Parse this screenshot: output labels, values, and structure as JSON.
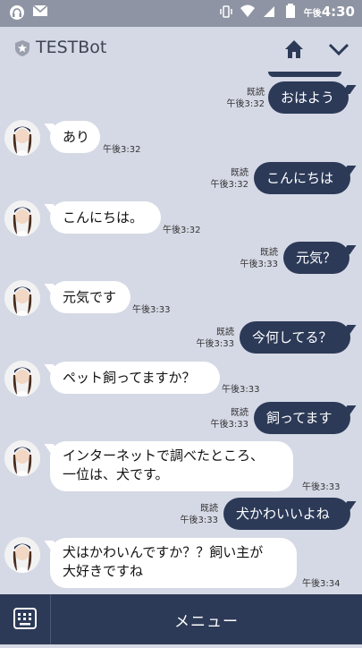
{
  "status_bar": {
    "time_prefix": "午後",
    "time": "4:30"
  },
  "header": {
    "title": "TESTBot",
    "icons": [
      "star-badge-icon",
      "home-icon",
      "chevron-down-icon"
    ]
  },
  "messages": [
    {
      "from": "me",
      "text": "おはよう",
      "read": "既読",
      "time": "午後3:32"
    },
    {
      "from": "bot",
      "text": "あり",
      "time": "午後3:32"
    },
    {
      "from": "me",
      "text": "こんにちは",
      "read": "既読",
      "time": "午後3:32"
    },
    {
      "from": "bot",
      "text": "こんにちは。",
      "time": "午後3:32"
    },
    {
      "from": "me",
      "text": "元気？",
      "read": "既読",
      "time": "午後3:33"
    },
    {
      "from": "bot",
      "text": "元気です",
      "time": "午後3:33"
    },
    {
      "from": "me",
      "text": "今何してる？",
      "read": "既読",
      "time": "午後3:33"
    },
    {
      "from": "bot",
      "text": "ペット飼ってますか？",
      "time": "午後3:33"
    },
    {
      "from": "me",
      "text": "飼ってます",
      "read": "既読",
      "time": "午後3:33"
    },
    {
      "from": "bot",
      "text": "インターネットで調べたところ、一位は、犬です。",
      "line1": "インターネットで調べたところ、",
      "line2": "一位は、犬です。",
      "time": "午後3:33"
    },
    {
      "from": "me",
      "text": "犬かわいいよね",
      "read": "既読",
      "time": "午後3:33"
    },
    {
      "from": "bot",
      "text": "犬はかわいんですか？？飼い主が大好きですね",
      "line1": "犬はかわいんですか？？飼い主が",
      "line2": "大好きですね",
      "time": "午後3:34"
    }
  ],
  "bottom_bar": {
    "menu_label": "メニュー",
    "keyboard_icon": "keyboard-icon"
  },
  "colors": {
    "background": "#d5d9e5",
    "my_bubble": "#2c3a58",
    "bot_bubble": "#ffffff",
    "bottom_bar": "#2d3a57",
    "status_bar": "#8e94a3"
  }
}
